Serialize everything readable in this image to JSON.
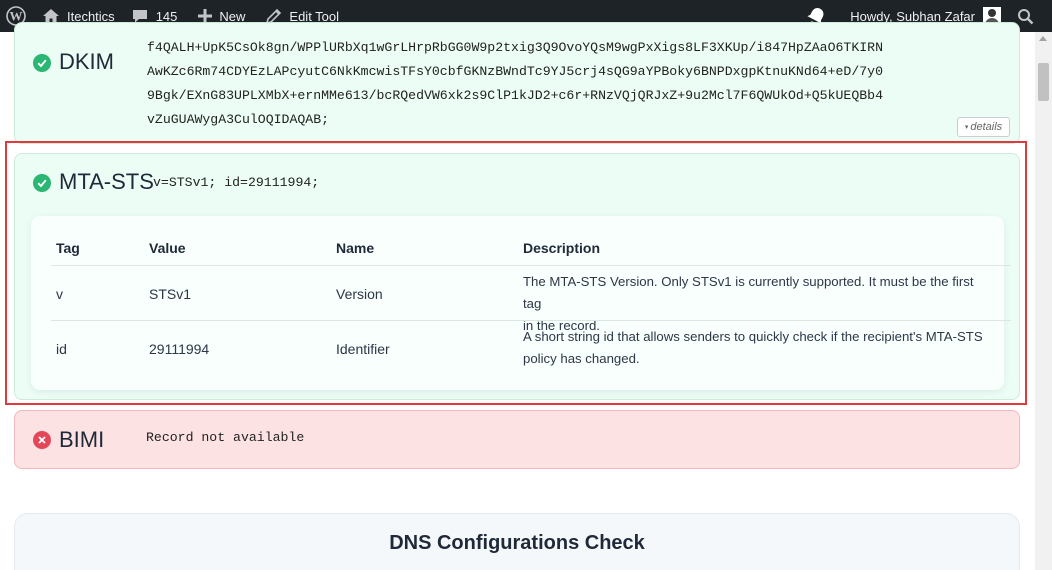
{
  "adminbar": {
    "site_name": "Itechtics",
    "comments_count": "145",
    "new_label": "New",
    "edit_label": "Edit Tool",
    "greeting": "Howdy, Subhan Zafar"
  },
  "records": {
    "dkim": {
      "name": "DKIM",
      "lines": [
        "f4QALH+UpK5CsOk8gn/WPPlURbXq1wGrLHrpRbGG0W9p2txig3Q9OvoYQsM9wgPxXigs8LF3XKUp/i847HpZAaO6TKIRN",
        "AwKZc6Rm74CDYEzLAPcyutC6NkKmcwisTFsY0cbfGKNzBWndTc9YJ5crj4sQG9aYPBoky6BNPDxgpKtnuKNd64+eD/7y0",
        "9Bgk/EXnG83UPLXMbX+ernMMe613/bcRQedVW6xk2s9ClP1kJD2+c6r+RNzVQjQRJxZ+9u2Mcl7F6QWUkOd+Q5kUEQBb4",
        "vZuGUAWygA3CulOQIDAQAB;"
      ],
      "details_label": "details"
    },
    "mta_sts": {
      "name": "MTA-STS",
      "value": "v=STSv1; id=29111994;",
      "columns": [
        "Tag",
        "Value",
        "Name",
        "Description"
      ],
      "rows": [
        {
          "tag": "v",
          "value": "STSv1",
          "name": "Version",
          "description_lines": [
            "The MTA-STS Version. Only STSv1 is currently supported. It must be the first tag",
            "in the record."
          ]
        },
        {
          "tag": "id",
          "value": "29111994",
          "name": "Identifier",
          "description_lines": [
            "A short string id that allows senders to quickly check if the recipient's MTA-STS",
            "policy has changed."
          ]
        }
      ]
    },
    "bimi": {
      "name": "BIMI",
      "value": "Record not available"
    }
  },
  "dns_section": {
    "title": "DNS Configurations Check"
  },
  "colors": {
    "adminbar": "#1d2327",
    "ok": "#2bb673",
    "error": "#e3485a",
    "highlight": "#e0393e"
  }
}
